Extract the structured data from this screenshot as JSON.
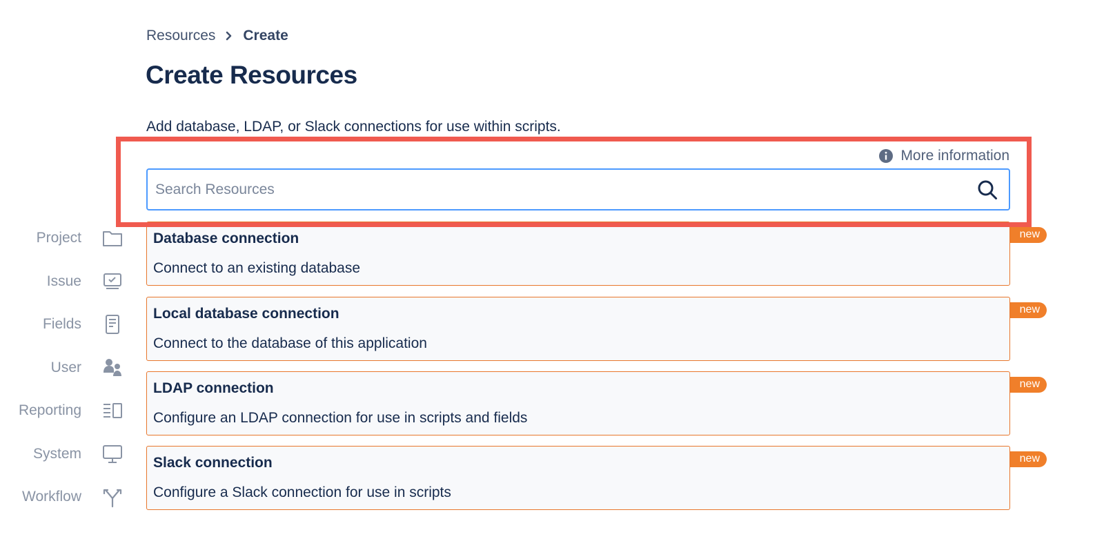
{
  "breadcrumb": {
    "parent": "Resources",
    "current": "Create"
  },
  "page_title": "Create Resources",
  "description": "Add database, LDAP, or Slack connections for use within scripts.",
  "more_info": {
    "label": "More information",
    "icon": "info-icon"
  },
  "search": {
    "placeholder": "Search Resources",
    "value": "",
    "icon": "search-icon"
  },
  "sidebar": {
    "items": [
      {
        "label": "Project",
        "icon": "folder-icon"
      },
      {
        "label": "Issue",
        "icon": "issue-screen-icon"
      },
      {
        "label": "Fields",
        "icon": "document-icon"
      },
      {
        "label": "User",
        "icon": "users-icon"
      },
      {
        "label": "Reporting",
        "icon": "list-report-icon"
      },
      {
        "label": "System",
        "icon": "monitor-icon"
      },
      {
        "label": "Workflow",
        "icon": "branch-icon"
      }
    ]
  },
  "resources": [
    {
      "title": "Database connection",
      "description": "Connect to an existing database",
      "badge": "new"
    },
    {
      "title": "Local database connection",
      "description": "Connect to the database of this application",
      "badge": "new"
    },
    {
      "title": "LDAP connection",
      "description": "Configure an LDAP connection for use in scripts and fields",
      "badge": "new"
    },
    {
      "title": "Slack connection",
      "description": "Configure a Slack connection for use in scripts",
      "badge": "new"
    }
  ],
  "colors": {
    "highlight": "#f05a4f",
    "card_border": "#e8762b",
    "badge": "#f07f2a",
    "search_border": "#4c9aff"
  }
}
